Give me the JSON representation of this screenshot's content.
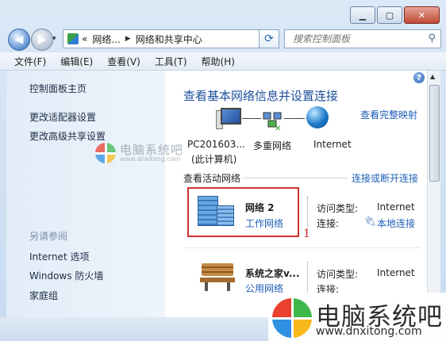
{
  "window": {
    "minimize_glyph": "▁",
    "maximize_glyph": "▢",
    "close_glyph": "✕"
  },
  "nav": {
    "back_glyph": "◀",
    "forward_glyph": "▶",
    "history_glyph": "▾",
    "address": {
      "overflow": "«",
      "segments": [
        "网络...",
        "网络和共享中心"
      ],
      "separator": "▶",
      "dropdown_glyph": "▾"
    },
    "refresh_glyph": "⟳",
    "search_placeholder": "搜索控制面板",
    "search_glyph": "⚲"
  },
  "menu": [
    "文件(F)",
    "编辑(E)",
    "查看(V)",
    "工具(T)",
    "帮助(H)"
  ],
  "sidebar": {
    "links": [
      "控制面板主页",
      "更改适配器设置",
      "更改高级共享设置"
    ],
    "see_also_heading": "另请参阅",
    "see_also": [
      "Internet 选项",
      "Windows 防火墙",
      "家庭组"
    ]
  },
  "main": {
    "help_glyph": "?",
    "title": "查看基本网络信息并设置连接",
    "view_full_map": "查看完整映射",
    "map": {
      "computer_name": "PC201603...",
      "computer_sub": "(此计算机)",
      "multiple_networks": "多重网络",
      "internet": "Internet",
      "green_mark": "✕"
    },
    "active_networks_heading": "查看活动网络",
    "connect_disconnect": "连接或断开连接",
    "networks": [
      {
        "name": "网络  2",
        "type": "工作网络",
        "access_label": "访问类型:",
        "access_value": "Internet",
        "conn_label": "连接:",
        "conn_value": "本地连接"
      },
      {
        "name": "系统之家v...",
        "type": "公用网络",
        "access_label": "访问类型:",
        "access_value": "Internet",
        "conn_label": "连接:",
        "conn_value": ""
      }
    ],
    "annotation": "1"
  },
  "watermark": {
    "small_text": "电脑系统吧",
    "small_url": "www.dnxitong.com",
    "big_text": "电脑系统吧",
    "big_url": "www.dnxitong.com"
  },
  "colors": {
    "link": "#1d5fb8",
    "title": "#1d4f9a",
    "highlight_box": "#d1322e"
  }
}
